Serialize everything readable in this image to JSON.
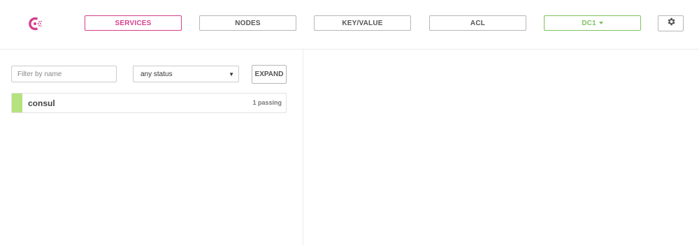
{
  "colors": {
    "brand": "#d63f8c",
    "dc_accent": "#7fc15f",
    "passing": "#b5e27e",
    "border": "#b7b7b7"
  },
  "header": {
    "logo_icon": "consul-logo-icon",
    "nav": [
      {
        "label": "SERVICES",
        "active": true
      },
      {
        "label": "NODES",
        "active": false
      },
      {
        "label": "KEY/VALUE",
        "active": false
      },
      {
        "label": "ACL",
        "active": false
      }
    ],
    "datacenter": {
      "label": "DC1"
    },
    "settings_icon": "gear-icon"
  },
  "filters": {
    "name_placeholder": "Filter by name",
    "name_value": "",
    "status_selected": "any status",
    "expand_label": "EXPAND"
  },
  "services": [
    {
      "name": "consul",
      "checks": "1 passing",
      "status": "passing"
    }
  ]
}
